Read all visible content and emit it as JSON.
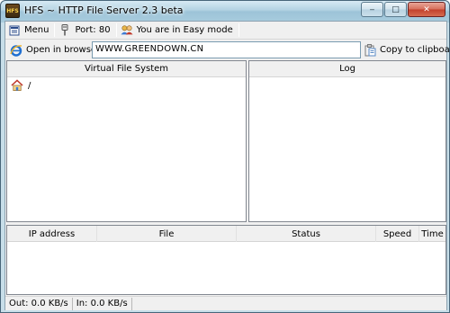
{
  "window": {
    "title": "HFS ~ HTTP File Server 2.3 beta",
    "app_icon_text": "HFS",
    "minimize_glyph": "‒",
    "maximize_glyph": "□",
    "close_glyph": "✕"
  },
  "toolbar": {
    "menu_label": "Menu",
    "port_label": "Port: 80",
    "mode_label": "You are in Easy mode"
  },
  "url_bar": {
    "open_browser_label": "Open in browser",
    "url_value": "WWW.GREENDOWN.CN",
    "copy_label": "Copy to clipboard"
  },
  "vfs": {
    "header": "Virtual File System",
    "root_label": "/"
  },
  "log": {
    "header": "Log"
  },
  "connections": {
    "columns": [
      "IP address",
      "File",
      "Status",
      "Speed",
      "Time"
    ]
  },
  "statusbar": {
    "out_label": "Out: 0.0 KB/s",
    "in_label": "In: 0.0 KB/s"
  },
  "colors": {
    "frame": "#a9cbdc",
    "client_bg": "#f0f0f0",
    "panel_border": "#828790",
    "close_red": "#c2412c"
  },
  "icons": [
    "hfs-app-icon",
    "menu-icon",
    "port-icon",
    "users-icon",
    "ie-icon",
    "clipboard-icon",
    "home-icon"
  ]
}
